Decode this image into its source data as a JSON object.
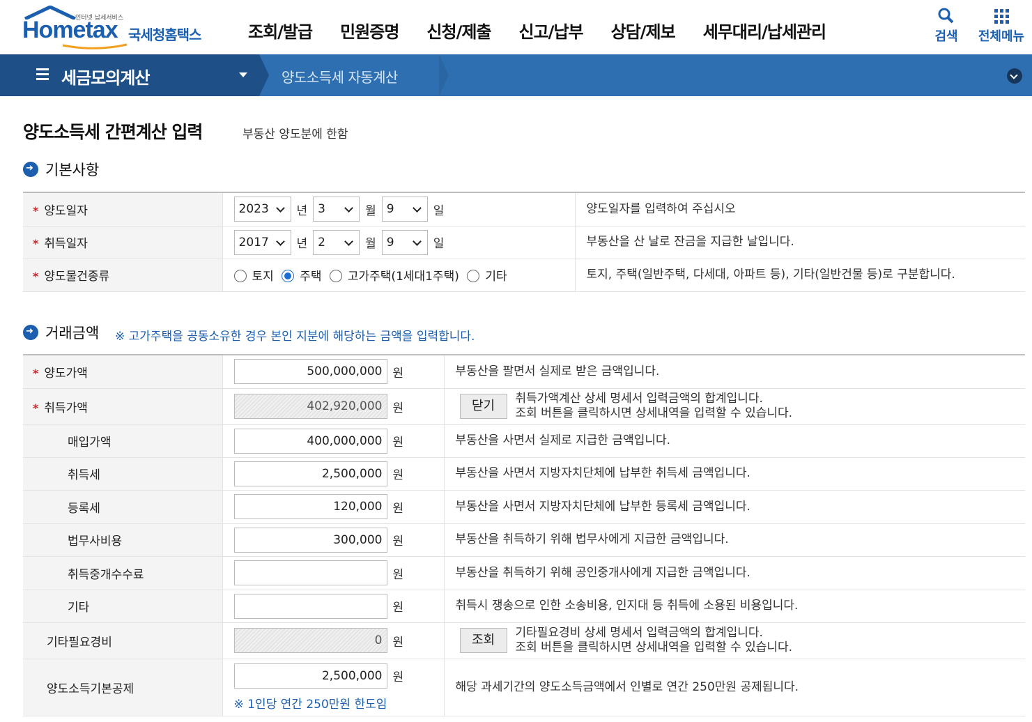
{
  "header": {
    "logo_text": "Hometax",
    "logo_small": "인터넷 납세서비스",
    "logo_kr": "국세청홈택스",
    "menu": [
      "조회/발급",
      "민원증명",
      "신청/제출",
      "신고/납부",
      "상담/제보",
      "세무대리/납세관리"
    ],
    "search_label": "검색",
    "allmenu_label": "전체메뉴"
  },
  "navbar": {
    "main_label": "세금모의계산",
    "sub_label": "양도소득세 자동계산"
  },
  "page": {
    "title": "양도소득세 간편계산 입력",
    "subtitle": "부동산 양도분에 한함"
  },
  "basic": {
    "heading": "기본사항",
    "transfer_date": {
      "label": "양도일자",
      "year": "2023",
      "month": "3",
      "day": "9",
      "desc": "양도일자를 입력하여 주십시오"
    },
    "acquire_date": {
      "label": "취득일자",
      "year": "2017",
      "month": "2",
      "day": "9",
      "desc": "부동산을 산 날로 잔금을 지급한 날입니다."
    },
    "units": {
      "year": "년",
      "month": "월",
      "day": "일"
    },
    "property_type": {
      "label": "양도물건종류",
      "options": [
        "토지",
        "주택",
        "고가주택(1세대1주택)",
        "기타"
      ],
      "selected": "주택",
      "desc": "토지, 주택(일반주택, 다세대, 아파트 등), 기타(일반건물 등)로 구분합니다."
    }
  },
  "amounts": {
    "heading": "거래금액",
    "note": "※ 고가주택을 공동소유한 경우 본인 지분에 해당하는 금액을 입력합니다.",
    "won": "원",
    "rows": [
      {
        "label": "양도가액",
        "value": "500,000,000",
        "desc": "부동산을 팔면서 실제로 받은 금액입니다."
      },
      {
        "label": "취득가액",
        "value": "402,920,000",
        "button": "닫기",
        "desc1": "취득가액계산 상세 명세서 입력금액의 합계입니다.",
        "desc2": "조회 버튼을 클릭하시면 상세내역을 입력할 수 있습니다."
      },
      {
        "label": "매입가액",
        "value": "400,000,000",
        "desc": "부동산을 사면서 실제로 지급한 금액입니다."
      },
      {
        "label": "취득세",
        "value": "2,500,000",
        "desc": "부동산을 사면서 지방자치단체에 납부한 취득세 금액입니다."
      },
      {
        "label": "등록세",
        "value": "120,000",
        "desc": "부동산을 사면서 지방자치단체에 납부한 등록세 금액입니다."
      },
      {
        "label": "법무사비용",
        "value": "300,000",
        "desc": "부동산을 취득하기 위해 법무사에게 지급한 금액입니다."
      },
      {
        "label": "취득중개수수료",
        "value": "",
        "desc": "부동산을 취득하기 위해 공인중개사에게 지급한 금액입니다."
      },
      {
        "label": "기타",
        "value": "",
        "desc": "취득시 쟁송으로 인한 소송비용, 인지대 등 취득에 소용된 비용입니다."
      },
      {
        "label": "기타필요경비",
        "value": "0",
        "button": "조회",
        "desc1": "기타필요경비 상세 명세서 입력금액의 합계입니다.",
        "desc2": "조회 버튼을 클릭하시면 상세내역을 입력할 수 있습니다."
      },
      {
        "label": "양도소득기본공제",
        "value": "2,500,000",
        "limit_note": "※ 1인당 연간 250만원 한도임",
        "desc": "해당 과세기간의 양도소득금액에서 인별로 연간 250만원 공제됩니다."
      }
    ]
  },
  "colors": {
    "primary": "#1b5fae",
    "nav_dark": "#1e4f86",
    "nav": "#2d6fb0",
    "required": "#c8262b"
  }
}
